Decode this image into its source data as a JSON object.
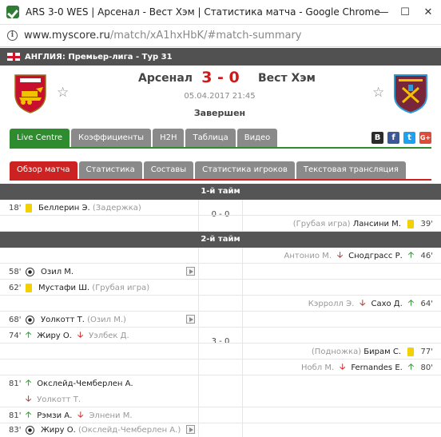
{
  "browser": {
    "tab_title": "ARS 3-0 WES | Арсенал - Вест Хэм | Статистика матча - Google Chrome",
    "url_host": "www.myscore.ru",
    "url_path": "/match/xA1hxHbK/#match-summary"
  },
  "league": {
    "label": "АНГЛИЯ: Премьер-лига - Тур 31"
  },
  "match": {
    "home": "Арсенал",
    "away": "Вест Хэм",
    "score": "3 - 0",
    "datetime": "05.04.2017 21:45",
    "status": "Завершен"
  },
  "colors": {
    "accent_green": "#2e8b2e",
    "accent_red": "#cc2222",
    "score_red": "#cc1b1b"
  },
  "main_tabs": [
    "Live Centre",
    "Коэффициенты",
    "H2H",
    "Таблица",
    "Видео"
  ],
  "social": [
    "В",
    "f",
    "t",
    "G+"
  ],
  "sub_tabs": [
    "Обзор матча",
    "Статистика",
    "Составы",
    "Статистика игроков",
    "Текстовая трансляция"
  ],
  "summary": {
    "half1": {
      "label": "1-й тайм",
      "score": "0 - 0"
    },
    "half2": {
      "label": "2-й тайм",
      "score": "3 - 0"
    },
    "e1": {
      "min": "18'",
      "player": "Беллерин Э.",
      "note": "(Задержка)"
    },
    "e2": {
      "min": "39'",
      "player": "Лансини М.",
      "note": "(Грубая игра)"
    },
    "e3": {
      "min": "46'",
      "in": "Снодграсс Р.",
      "out": "Антонио М."
    },
    "e4": {
      "min": "58'",
      "player": "Озил М."
    },
    "e5": {
      "min": "62'",
      "player": "Мустафи Ш.",
      "note": "(Грубая игра)"
    },
    "e6": {
      "min": "64'",
      "in": "Сахо Д.",
      "out": "Кэрролл Э."
    },
    "e7": {
      "min": "68'",
      "player": "Уолкотт Т.",
      "note": "(Озил М.)"
    },
    "e8": {
      "min": "74'",
      "in": "Жиру О.",
      "out": "Уэлбек Д."
    },
    "e9": {
      "min": "77'",
      "player": "Бирам С.",
      "note": "(Подножка)"
    },
    "e10": {
      "min": "80'",
      "in": "Fernandes E.",
      "out": "Нобл М."
    },
    "e11": {
      "min": "81'",
      "in": "Окслейд-Чемберлен А.",
      "out": "Уолкотт Т."
    },
    "e12": {
      "min": "81'",
      "in": "Рэмзи А.",
      "out": "Элнени М."
    },
    "e13": {
      "min": "83'",
      "player": "Жиру О.",
      "note": "(Окслейд-Чемберлен А.)"
    }
  }
}
